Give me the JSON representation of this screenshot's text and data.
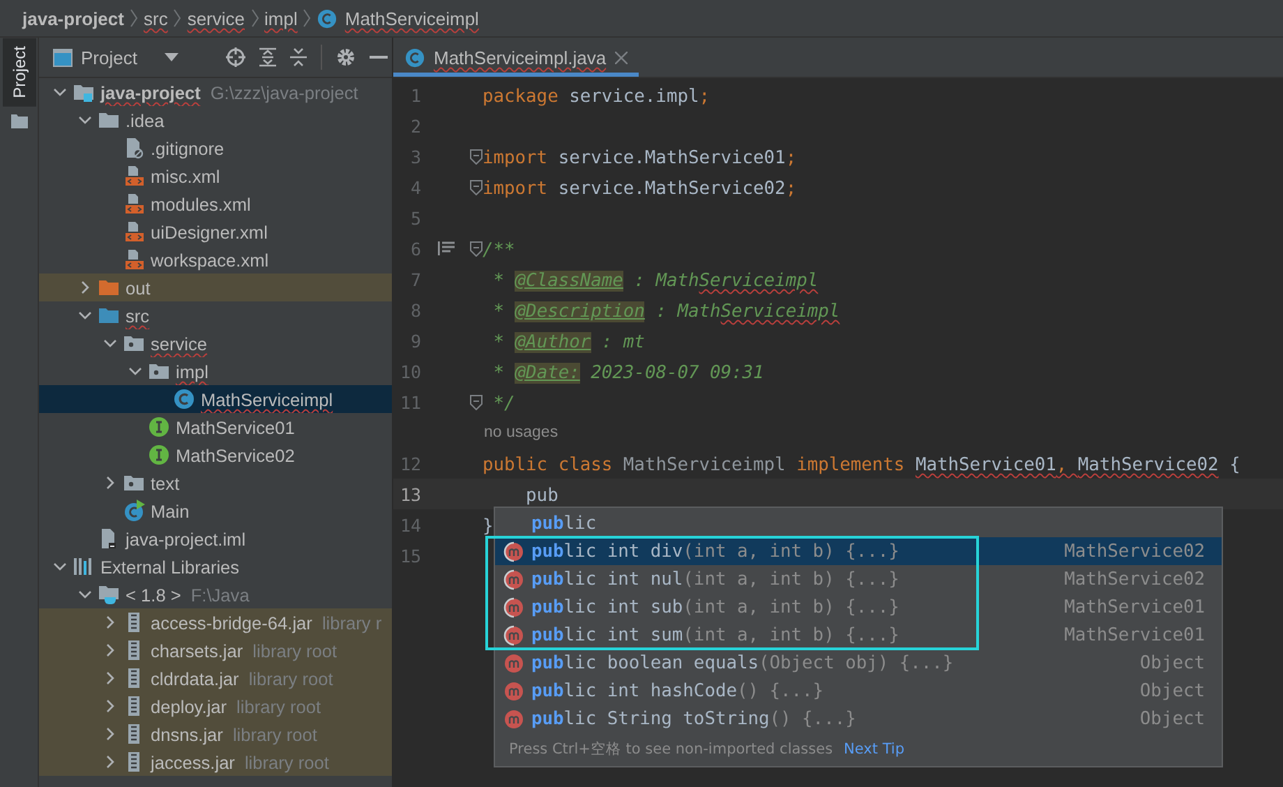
{
  "breadcrumb": [
    {
      "label": "java-project",
      "kind": "project",
      "typo": false
    },
    {
      "label": "src",
      "kind": "folder",
      "typo": true
    },
    {
      "label": "service",
      "kind": "folder",
      "typo": true
    },
    {
      "label": "impl",
      "kind": "folder",
      "typo": true
    },
    {
      "label": "MathServiceimpl",
      "kind": "class",
      "typo": true
    }
  ],
  "side_strip": {
    "tab": "Project"
  },
  "project_panel": {
    "title": "Project",
    "tree": [
      {
        "label": "java-project",
        "kind": "project",
        "hint": "G:\\zzz\\java-project",
        "expanded": true,
        "selected": false,
        "highlighted": false,
        "typo": true,
        "bold": true,
        "children": [
          {
            "label": ".idea",
            "kind": "folder",
            "expanded": true,
            "selected": false,
            "highlighted": false,
            "typo": false,
            "children": [
              {
                "label": ".gitignore",
                "kind": "ignore",
                "selected": false,
                "highlighted": false,
                "typo": false
              },
              {
                "label": "misc.xml",
                "kind": "xml",
                "selected": false,
                "highlighted": false,
                "typo": false
              },
              {
                "label": "modules.xml",
                "kind": "xml",
                "selected": false,
                "highlighted": false,
                "typo": false
              },
              {
                "label": "uiDesigner.xml",
                "kind": "xml",
                "selected": false,
                "highlighted": false,
                "typo": false
              },
              {
                "label": "workspace.xml",
                "kind": "xml",
                "selected": false,
                "highlighted": false,
                "typo": false
              }
            ]
          },
          {
            "label": "out",
            "kind": "excluded",
            "expanded": false,
            "selected": false,
            "highlighted": true,
            "typo": false
          },
          {
            "label": "src",
            "kind": "source",
            "expanded": true,
            "selected": false,
            "highlighted": false,
            "typo": true,
            "children": [
              {
                "label": "service",
                "kind": "package",
                "expanded": true,
                "selected": false,
                "highlighted": false,
                "typo": true,
                "children": [
                  {
                    "label": "impl",
                    "kind": "package",
                    "expanded": true,
                    "selected": false,
                    "highlighted": false,
                    "typo": true,
                    "children": [
                      {
                        "label": "MathServiceimpl",
                        "kind": "class",
                        "selected": true,
                        "typo": true
                      }
                    ]
                  },
                  {
                    "label": "MathService01",
                    "kind": "interface",
                    "selected": false,
                    "highlighted": false,
                    "typo": false
                  },
                  {
                    "label": "MathService02",
                    "kind": "interface",
                    "selected": false,
                    "highlighted": false,
                    "typo": false
                  }
                ]
              },
              {
                "label": "text",
                "kind": "package",
                "expanded": false,
                "selected": false,
                "highlighted": false,
                "typo": false
              },
              {
                "label": "Main",
                "kind": "main",
                "selected": false,
                "highlighted": false,
                "typo": false
              }
            ]
          },
          {
            "label": "java-project.iml",
            "kind": "iml",
            "selected": false,
            "highlighted": false,
            "typo": false
          }
        ]
      },
      {
        "label": "External Libraries",
        "kind": "libraries",
        "expanded": true,
        "selected": false,
        "highlighted": false,
        "typo": false,
        "children": [
          {
            "label": "< 1.8 >",
            "kind": "jdk",
            "hint": "F:\\Java",
            "expanded": true,
            "selected": false,
            "highlighted": false,
            "typo": false,
            "children": [
              {
                "label": "access-bridge-64.jar",
                "kind": "jar",
                "hint": "library r",
                "expanded": false,
                "selected": false,
                "highlighted": true,
                "typo": false
              },
              {
                "label": "charsets.jar",
                "kind": "jar",
                "hint": "library root",
                "expanded": false,
                "selected": false,
                "highlighted": true,
                "typo": false
              },
              {
                "label": "cldrdata.jar",
                "kind": "jar",
                "hint": "library root",
                "expanded": false,
                "selected": false,
                "highlighted": true,
                "typo": false
              },
              {
                "label": "deploy.jar",
                "kind": "jar",
                "hint": "library root",
                "expanded": false,
                "selected": false,
                "highlighted": true,
                "typo": false
              },
              {
                "label": "dnsns.jar",
                "kind": "jar",
                "hint": "library root",
                "expanded": false,
                "selected": false,
                "highlighted": true,
                "typo": false
              },
              {
                "label": "jaccess.jar",
                "kind": "jar",
                "hint": "library root",
                "expanded": false,
                "selected": false,
                "highlighted": true,
                "typo": false
              }
            ]
          }
        ]
      }
    ]
  },
  "editor": {
    "tabs": [
      {
        "label": "MathServiceimpl.java",
        "selected": true,
        "typo": true
      }
    ],
    "lines": [
      {
        "number": "1",
        "current": false,
        "fold": false,
        "doc_icon": false,
        "tokens": [
          {
            "text": "package ",
            "kind": "keyword",
            "typo": false
          },
          {
            "text": "service.impl",
            "kind": "plain",
            "typo": false
          },
          {
            "text": ";",
            "kind": "keyword",
            "typo": false
          }
        ]
      },
      {
        "number": "2",
        "current": false,
        "fold": false,
        "doc_icon": false
      },
      {
        "number": "3",
        "current": false,
        "fold": true,
        "doc_icon": false,
        "tokens": [
          {
            "text": "import ",
            "kind": "keyword",
            "typo": false
          },
          {
            "text": "service.MathService01",
            "kind": "plain",
            "typo": false
          },
          {
            "text": ";",
            "kind": "keyword",
            "typo": false
          }
        ]
      },
      {
        "number": "4",
        "current": false,
        "fold": true,
        "doc_icon": false,
        "tokens": [
          {
            "text": "import ",
            "kind": "keyword",
            "typo": false
          },
          {
            "text": "service.MathService02",
            "kind": "plain",
            "typo": false
          },
          {
            "text": ";",
            "kind": "keyword",
            "typo": false
          }
        ]
      },
      {
        "number": "5",
        "current": false,
        "fold": false,
        "doc_icon": false
      },
      {
        "number": "6",
        "current": false,
        "fold": true,
        "doc_icon": true,
        "tokens": [
          {
            "text": "/**",
            "kind": "doc",
            "typo": false
          }
        ]
      },
      {
        "number": "7",
        "current": false,
        "fold": false,
        "doc_icon": false,
        "tokens": [
          {
            "text": " * ",
            "kind": "doc",
            "typo": false
          },
          {
            "text": "@ClassName",
            "kind": "tag",
            "typo": false
          },
          {
            "text": " : Math",
            "kind": "doc",
            "typo": false
          },
          {
            "text": "Serviceimpl",
            "kind": "doc",
            "typo": true
          }
        ]
      },
      {
        "number": "8",
        "current": false,
        "fold": false,
        "doc_icon": false,
        "tokens": [
          {
            "text": " * ",
            "kind": "doc",
            "typo": false
          },
          {
            "text": "@Description",
            "kind": "tag",
            "typo": false
          },
          {
            "text": " : Math",
            "kind": "doc",
            "typo": false
          },
          {
            "text": "Serviceimpl",
            "kind": "doc",
            "typo": true
          }
        ]
      },
      {
        "number": "9",
        "current": false,
        "fold": false,
        "doc_icon": false,
        "tokens": [
          {
            "text": " * ",
            "kind": "doc",
            "typo": false
          },
          {
            "text": "@Author",
            "kind": "tag",
            "typo": false
          },
          {
            "text": " : mt",
            "kind": "doc",
            "typo": false
          }
        ]
      },
      {
        "number": "10",
        "current": false,
        "fold": false,
        "doc_icon": false,
        "tokens": [
          {
            "text": " * ",
            "kind": "doc",
            "typo": false
          },
          {
            "text": "@Date:",
            "kind": "tag",
            "typo": false
          },
          {
            "text": " 2023-08-07 09:31",
            "kind": "doc",
            "typo": false
          }
        ]
      },
      {
        "number": "11",
        "current": false,
        "fold": true,
        "doc_icon": false,
        "tokens": [
          {
            "text": " */",
            "kind": "doc",
            "typo": false
          }
        ]
      },
      {
        "kind": "hint",
        "text": "no usages"
      },
      {
        "number": "12",
        "current": false,
        "fold": false,
        "doc_icon": false,
        "tokens": [
          {
            "text": "public class ",
            "kind": "keyword",
            "typo": false
          },
          {
            "text": "MathServiceimpl",
            "kind": "unused",
            "typo": false
          },
          {
            "text": " implements ",
            "kind": "keyword",
            "typo": false
          },
          {
            "text": "MathService01",
            "kind": "plain",
            "typo": true
          },
          {
            "text": ", ",
            "kind": "keyword",
            "typo": true
          },
          {
            "text": "MathService02",
            "kind": "plain",
            "typo": true
          },
          {
            "text": " {",
            "kind": "plain",
            "typo": false
          }
        ]
      },
      {
        "number": "13",
        "current": true,
        "fold": false,
        "doc_icon": false,
        "tokens": [
          {
            "text": "    pub",
            "kind": "plain",
            "typo": false
          }
        ]
      },
      {
        "number": "14",
        "current": false,
        "fold": false,
        "doc_icon": false,
        "tokens": [
          {
            "text": "}",
            "kind": "plain",
            "typo": false
          }
        ]
      },
      {
        "number": "15",
        "current": false,
        "fold": false,
        "doc_icon": false
      }
    ],
    "completion": {
      "sections": [
        {
          "framed": false,
          "items": [
            {
              "kind": "keyword",
              "match": "pub",
              "rest": "lic",
              "selected": false
            }
          ]
        },
        {
          "framed": true,
          "items": [
            {
              "kind": "abstract",
              "match": "pub",
              "rest": "lic int div",
              "params": "(int a, int b) {...}",
              "source": "MathService02",
              "selected": true
            },
            {
              "kind": "abstract",
              "match": "pub",
              "rest": "lic int nul",
              "params": "(int a, int b) {...}",
              "source": "MathService02",
              "selected": false
            },
            {
              "kind": "abstract",
              "match": "pub",
              "rest": "lic int sub",
              "params": "(int a, int b) {...}",
              "source": "MathService01",
              "selected": false
            },
            {
              "kind": "abstract",
              "match": "pub",
              "rest": "lic int sum",
              "params": "(int a, int b) {...}",
              "source": "MathService01",
              "selected": false
            }
          ]
        },
        {
          "framed": false,
          "items": [
            {
              "kind": "method",
              "match": "pub",
              "rest": "lic boolean equals",
              "params": "(Object obj) {...}",
              "source": "Object",
              "selected": false
            },
            {
              "kind": "method",
              "match": "pub",
              "rest": "lic int hashCode",
              "params": "() {...}",
              "source": "Object",
              "selected": false
            },
            {
              "kind": "method",
              "match": "pub",
              "rest": "lic String toString",
              "params": "() {...}",
              "source": "Object",
              "selected": false
            }
          ]
        }
      ],
      "footer": "Press Ctrl+空格 to see non-imported classes",
      "footer_link": "Next Tip"
    }
  }
}
